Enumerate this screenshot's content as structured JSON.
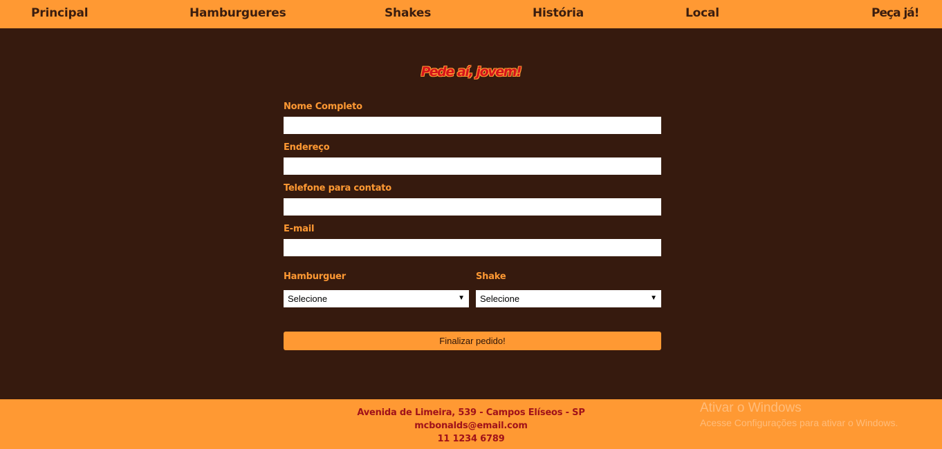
{
  "nav": {
    "items": [
      "Principal",
      "Hamburgueres",
      "Shakes",
      "História",
      "Local"
    ],
    "cta": "Peça já!"
  },
  "form": {
    "title": "Pede aí, jovem!",
    "fields": [
      {
        "label": "Nome Completo",
        "value": ""
      },
      {
        "label": "Endereço",
        "value": ""
      },
      {
        "label": "Telefone para contato",
        "value": ""
      },
      {
        "label": "E-mail",
        "value": ""
      }
    ],
    "hamburguer": {
      "label": "Hamburguer",
      "selected": "Selecione"
    },
    "shake": {
      "label": "Shake",
      "selected": "Selecione"
    },
    "submit_label": "Finalizar pedido!"
  },
  "footer": {
    "address": "Avenida de Limeira, 539 - Campos Elíseos - SP",
    "email": "mcbonalds@email.com",
    "phone": "11 1234 6789"
  },
  "watermark": {
    "title": "Ativar o Windows",
    "subtitle": "Acesse Configurações para ativar o Windows."
  },
  "colors": {
    "accent": "#ff9933",
    "background": "#361a0e",
    "title_red": "#d4141a",
    "footer_text": "#a0121a"
  }
}
